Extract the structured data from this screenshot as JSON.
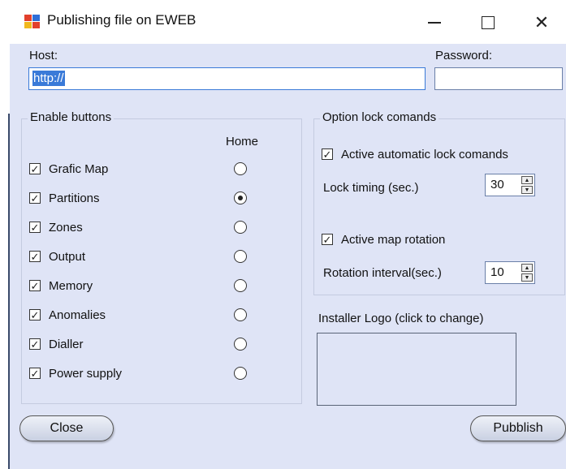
{
  "window": {
    "title": "Publishing file on EWEB"
  },
  "host": {
    "label": "Host:",
    "value": "http://"
  },
  "password": {
    "label": "Password:",
    "value": ""
  },
  "enable_buttons": {
    "legend": "Enable buttons",
    "home_header": "Home",
    "items": [
      {
        "label": "Grafic Map",
        "checked": true,
        "home": false
      },
      {
        "label": "Partitions",
        "checked": true,
        "home": true
      },
      {
        "label": "Zones",
        "checked": true,
        "home": false
      },
      {
        "label": "Output",
        "checked": true,
        "home": false
      },
      {
        "label": "Memory",
        "checked": true,
        "home": false
      },
      {
        "label": "Anomalies",
        "checked": true,
        "home": false
      },
      {
        "label": "Dialler",
        "checked": true,
        "home": false
      },
      {
        "label": "Power supply",
        "checked": true,
        "home": false
      }
    ]
  },
  "option_lock": {
    "legend": "Option lock comands",
    "auto_lock": {
      "label": "Active automatic lock comands",
      "checked": true
    },
    "lock_timing": {
      "label": "Lock timing (sec.)",
      "value": "30"
    },
    "map_rotation": {
      "label": "Active map rotation",
      "checked": true
    },
    "rotation_interval": {
      "label": "Rotation interval(sec.)",
      "value": "10"
    }
  },
  "installer_logo": {
    "label": "Installer Logo (click to change)"
  },
  "buttons": {
    "close": "Close",
    "publish": "Pubblish"
  },
  "check_glyph": "✓",
  "colors": {
    "dialog_bg": "#dfe4f6",
    "selection": "#3a7ad8"
  }
}
